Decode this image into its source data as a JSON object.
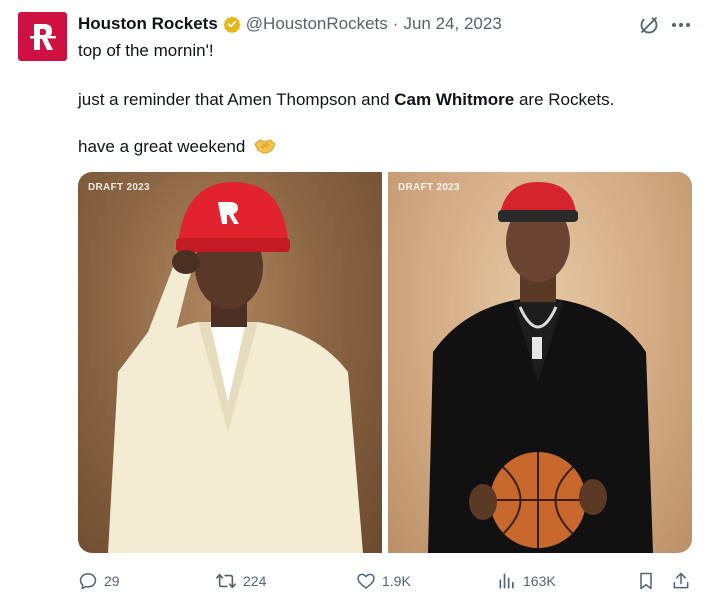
{
  "author": {
    "display_name": "Houston Rockets",
    "handle": "@HoustonRockets",
    "separator": "·",
    "date": "Jun 24, 2023",
    "verified": true,
    "brand_color": "#ce1141"
  },
  "tweet": {
    "line1": "top of the mornin'!",
    "line2_part1": "just a reminder that Amen Thompson and ",
    "line2_bold": "Cam Whitmore",
    "line2_part2": " are Rockets.",
    "line3": "have a great weekend",
    "emoji": "handshake"
  },
  "media": [
    {
      "draft_label": "DRAFT 2023",
      "description_icon": "player-photo"
    },
    {
      "draft_label": "DRAFT 2023",
      "description_icon": "player-photo"
    }
  ],
  "actions": {
    "replies": "29",
    "reposts": "224",
    "likes": "1.9K",
    "views": "163K"
  },
  "colors": {
    "text": "#0f1419",
    "secondary": "#536471",
    "verified_gold": "#e2b719"
  }
}
